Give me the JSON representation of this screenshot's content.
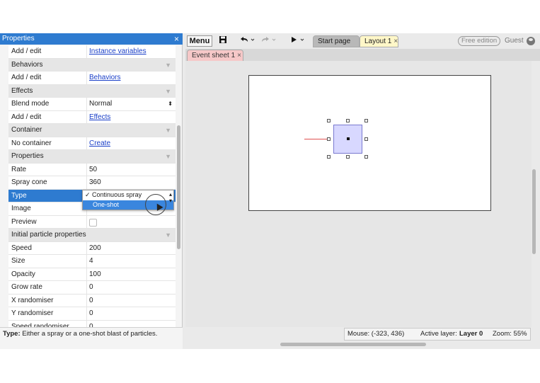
{
  "properties_panel": {
    "title": "Properties",
    "close": "×",
    "rows": [
      {
        "key": "Add / edit",
        "value": "Instance variables",
        "kind": "link"
      },
      {
        "key": "Behaviors",
        "kind": "section"
      },
      {
        "key": "Add / edit",
        "value": "Behaviors",
        "kind": "link"
      },
      {
        "key": "Effects",
        "kind": "section"
      },
      {
        "key": "Blend mode",
        "value": "Normal",
        "kind": "select"
      },
      {
        "key": "Add / edit",
        "value": "Effects",
        "kind": "link"
      },
      {
        "key": "Container",
        "kind": "section"
      },
      {
        "key": "No container",
        "value": "Create",
        "kind": "link"
      },
      {
        "key": "Properties",
        "kind": "section"
      },
      {
        "key": "Rate",
        "value": "50",
        "kind": "text"
      },
      {
        "key": "Spray cone",
        "value": "360",
        "kind": "text"
      },
      {
        "key": "Type",
        "value": "",
        "kind": "selected"
      },
      {
        "key": "Image",
        "value": "",
        "kind": "text"
      },
      {
        "key": "Preview",
        "value": "",
        "kind": "checkbox"
      },
      {
        "key": "Initial particle properties",
        "kind": "section"
      },
      {
        "key": "Speed",
        "value": "200",
        "kind": "text"
      },
      {
        "key": "Size",
        "value": "4",
        "kind": "text"
      },
      {
        "key": "Opacity",
        "value": "100",
        "kind": "text"
      },
      {
        "key": "Grow rate",
        "value": "0",
        "kind": "text"
      },
      {
        "key": "X randomiser",
        "value": "0",
        "kind": "text"
      },
      {
        "key": "Y randomiser",
        "value": "0",
        "kind": "text"
      },
      {
        "key": "Speed randomiser",
        "value": "0",
        "kind": "text"
      }
    ],
    "dropdown": {
      "options": [
        "✓ Continuous spray",
        "One-shot"
      ],
      "highlighted": "One-shot"
    },
    "status_label": "Type:",
    "status_text": "Either a spray or a one-shot blast of particles."
  },
  "toolbar": {
    "menu_label": "Menu",
    "save_icon": "save-icon",
    "undo_icon": "undo-icon",
    "redo_icon": "redo-icon",
    "play_icon": "play-icon",
    "tabs": [
      {
        "label": "Start page"
      },
      {
        "label": "Layout 1",
        "close": "×"
      }
    ],
    "edition_badge": "Free edition",
    "user_label": "Guest"
  },
  "subtabs": [
    {
      "label": "Event sheet 1",
      "close": "×"
    }
  ],
  "statusbar": {
    "mouse": "Mouse: (-323, 436)",
    "active_layer_label": "Active layer:",
    "active_layer_value": "Layer 0",
    "zoom": "Zoom: 55%"
  }
}
